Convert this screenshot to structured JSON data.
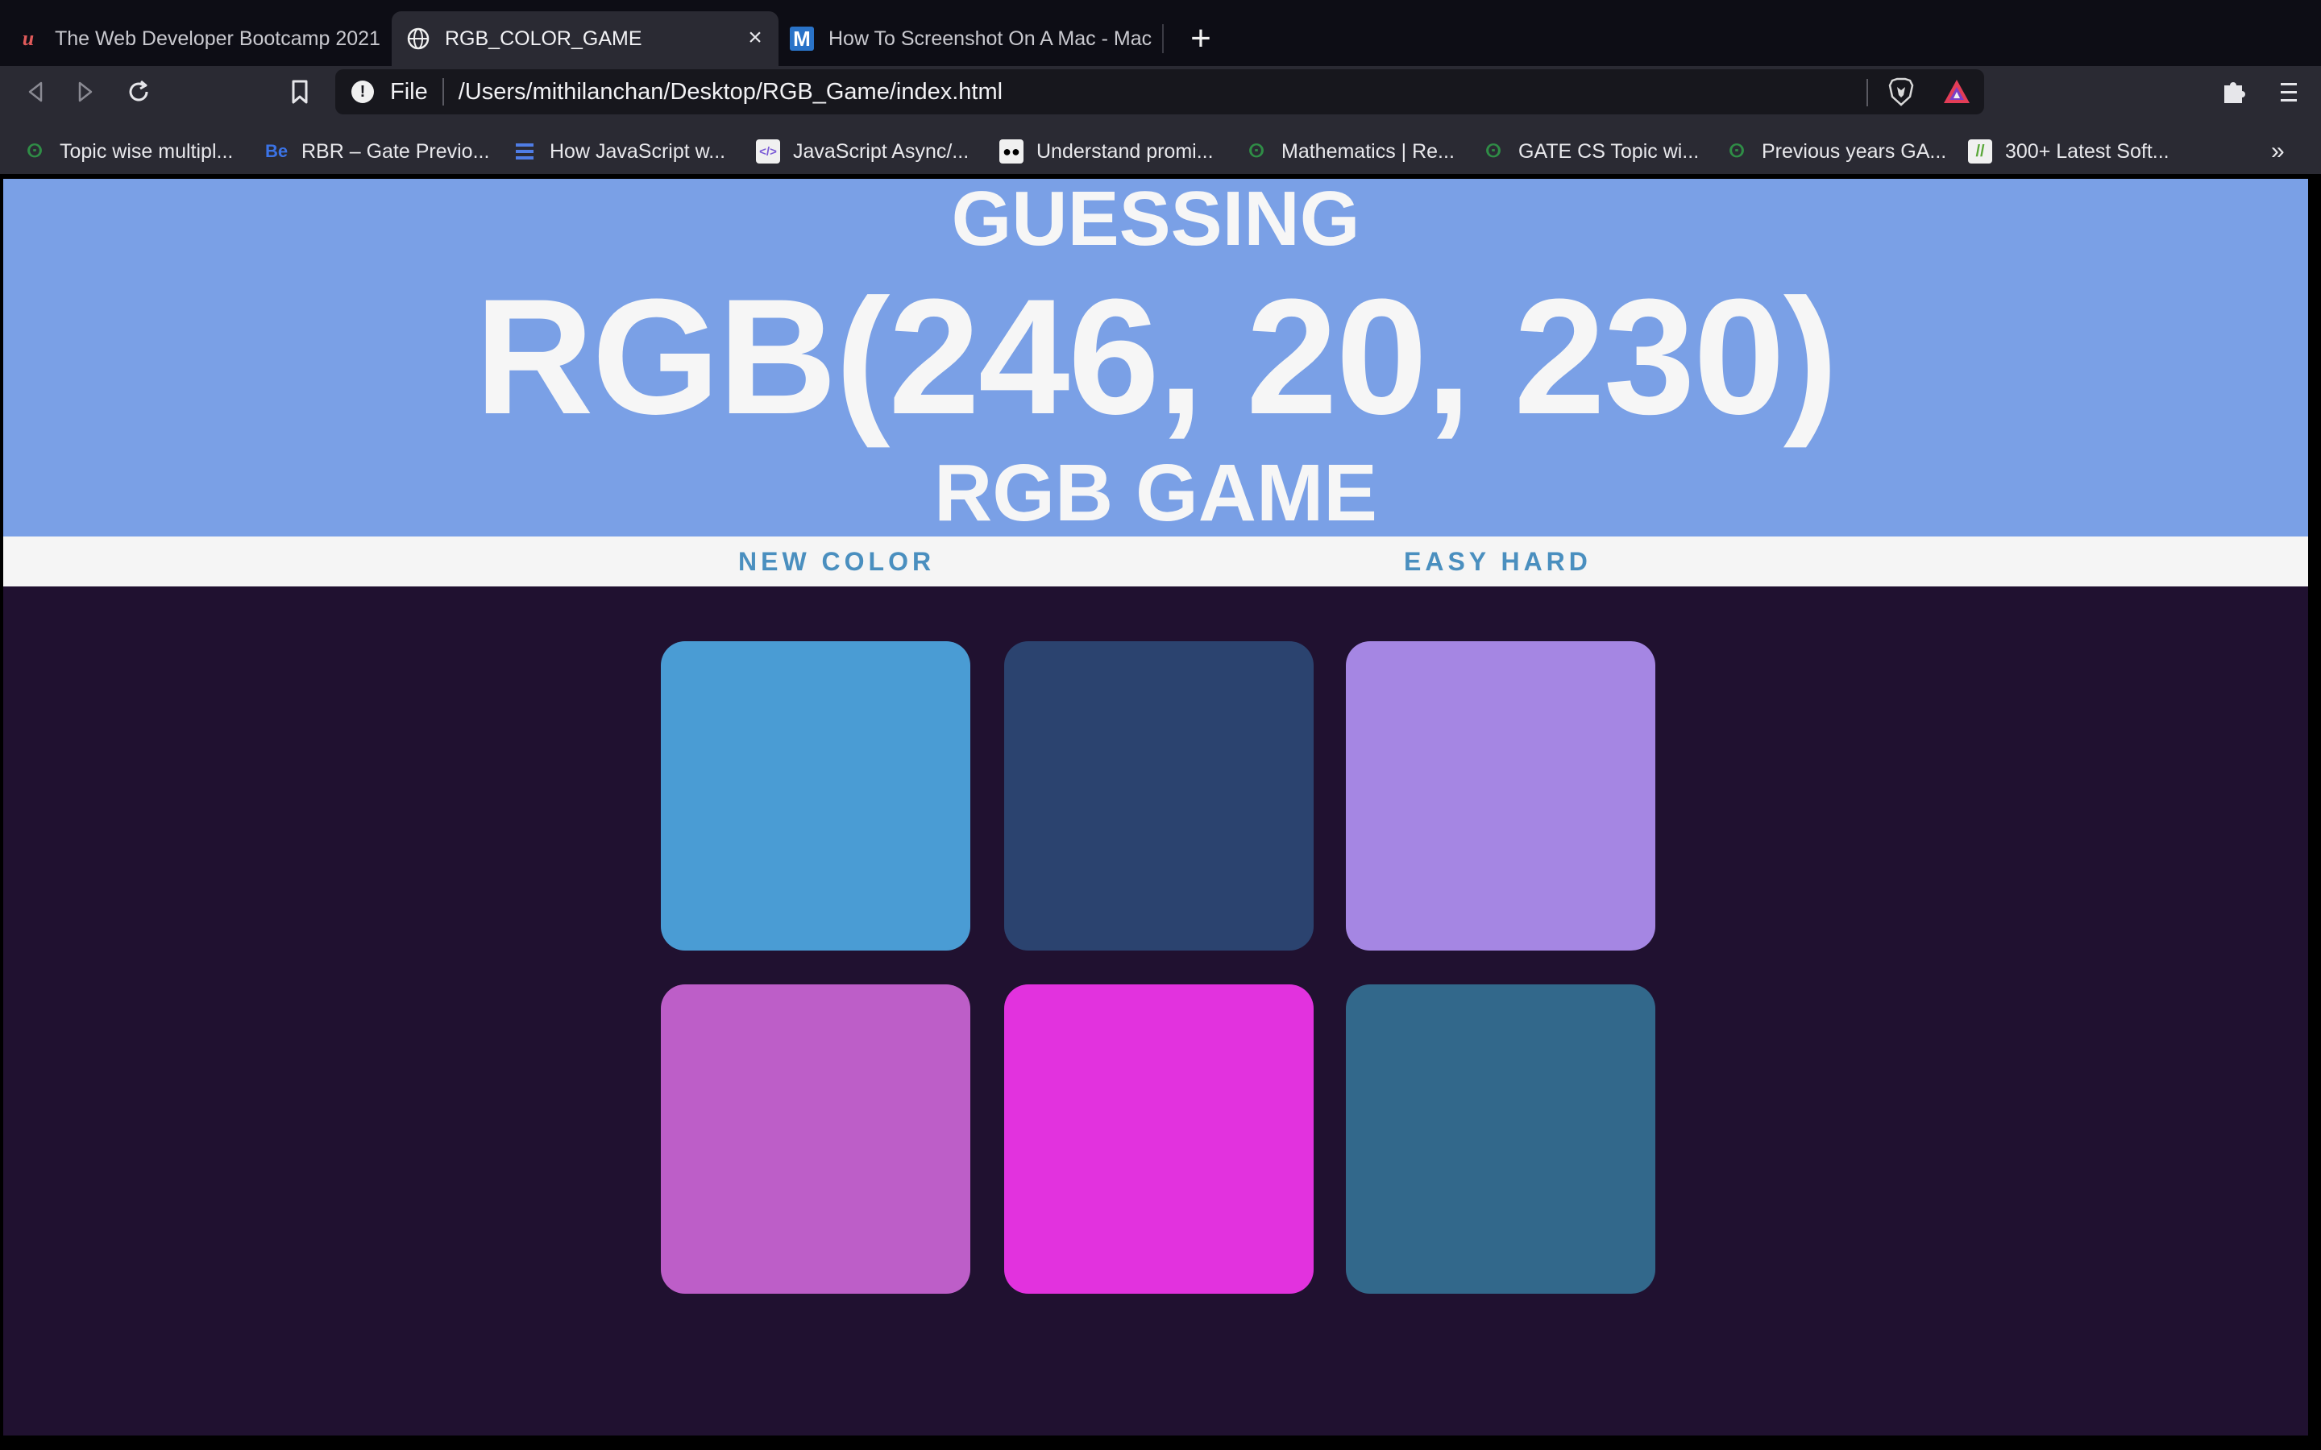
{
  "browser": {
    "tabs": [
      {
        "title": "The Web Developer Bootcamp 2021",
        "icon": "udemy-icon",
        "active": false
      },
      {
        "title": "RGB_COLOR_GAME",
        "icon": "globe-icon",
        "active": true
      },
      {
        "title": "How To Screenshot On A Mac - Mac",
        "icon": "m-logo-icon",
        "active": false
      }
    ],
    "new_tab_label": "+",
    "address": {
      "scheme": "File",
      "url": "/Users/mithilanchan/Desktop/RGB_Game/index.html"
    },
    "bookmarks": [
      {
        "label": "Topic wise multipl...",
        "icon": "gfg-icon"
      },
      {
        "label": "RBR – Gate Previo...",
        "icon": "behance-icon"
      },
      {
        "label": "How JavaScript w...",
        "icon": "doc-icon"
      },
      {
        "label": "JavaScript Async/...",
        "icon": "code-icon"
      },
      {
        "label": "Understand promi...",
        "icon": "medium-icon"
      },
      {
        "label": "Mathematics | Re...",
        "icon": "gfg-icon"
      },
      {
        "label": "GATE CS Topic wi...",
        "icon": "gfg-icon"
      },
      {
        "label": "Previous years GA...",
        "icon": "gfg-icon"
      },
      {
        "label": "300+ Latest Soft...",
        "icon": "leaf-icon"
      }
    ],
    "bookmarks_overflow": "»"
  },
  "game": {
    "status_text": "GUESSING",
    "target_color": "RGB(246, 20, 230)",
    "title": "RGB GAME",
    "new_color_label": "NEW COLOR",
    "mode_label": "EASY HARD",
    "header_color": "#7aa0e6",
    "background_color": "#201130",
    "squares": [
      {
        "color": "#4a9cd4"
      },
      {
        "color": "#2b436f"
      },
      {
        "color": "#a586e3"
      },
      {
        "color": "#bd5ec8"
      },
      {
        "color": "#e232de"
      },
      {
        "color": "#32688b"
      }
    ]
  }
}
